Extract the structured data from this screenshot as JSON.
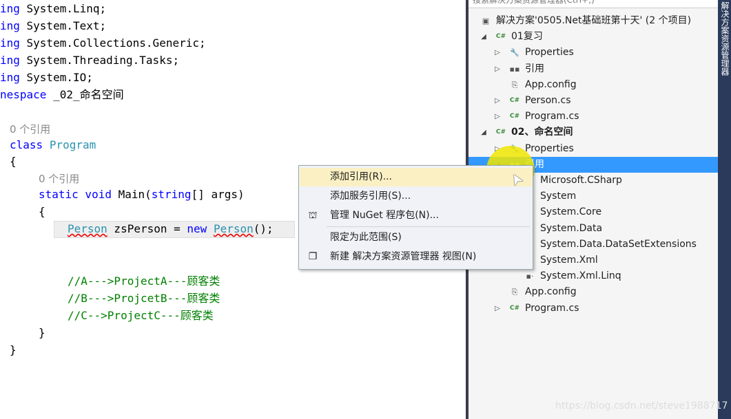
{
  "editor": {
    "usings": [
      "ing System.Linq;",
      "ing System.Text;",
      "ing System.Collections.Generic;",
      "ing System.Threading.Tasks;",
      "ing System.IO;"
    ],
    "namespace_kw": "nespace",
    "namespace_name": " _02_命名空间",
    "ref_class": "0 个引用",
    "class_kw": "class",
    "class_name": "Program",
    "brace_open": "{",
    "ref_main": "0 个引用",
    "main_sig_kw": "static void",
    "main_name": " Main(",
    "string_kw": "string",
    "main_args": "[] args)",
    "brace2": "{",
    "stmt_type": "Person",
    "stmt_var": " zsPerson = ",
    "stmt_new": "new",
    "stmt_ctor": "Person",
    "stmt_end": "();",
    "comments": [
      "//A--->ProjectA---顾客类",
      "//B--->ProjcetB---顾客类",
      "//C-->ProjectC---顾客类"
    ],
    "brace3": "}",
    "brace4": "}"
  },
  "solution_explorer": {
    "search_placeholder": "搜索解决方案资源管理器(Ctrl+;)",
    "side_tab": "解决方案资源管理器",
    "items": [
      {
        "label": "解决方案'0505.Net基础班第十天' (2 个项目)",
        "icon": "solution-icon",
        "level": 0,
        "expander": ""
      },
      {
        "label": "01复习",
        "icon": "csharp-project-icon",
        "level": 1,
        "expander": "◢"
      },
      {
        "label": "Properties",
        "icon": "wrench-icon",
        "level": 2,
        "expander": "▷"
      },
      {
        "label": "引用",
        "icon": "references-icon",
        "level": 2,
        "expander": "▷"
      },
      {
        "label": "App.config",
        "icon": "config-file-icon",
        "level": 2,
        "expander": ""
      },
      {
        "label": "Person.cs",
        "icon": "csharp-file-icon",
        "level": 2,
        "expander": "▷"
      },
      {
        "label": "Program.cs",
        "icon": "csharp-file-icon",
        "level": 2,
        "expander": "▷"
      },
      {
        "label": "02、命名空间",
        "icon": "csharp-project-icon",
        "level": 1,
        "expander": "◢",
        "bold": true
      },
      {
        "label": "Properties",
        "icon": "wrench-icon",
        "level": 2,
        "expander": "▷"
      },
      {
        "label": "引用",
        "icon": "references-icon",
        "level": 2,
        "expander": "◢",
        "selected": true
      },
      {
        "label": "Microsoft.CSharp",
        "icon": "reference-icon",
        "level": 3,
        "expander": ""
      },
      {
        "label": "System",
        "icon": "reference-icon",
        "level": 3,
        "expander": ""
      },
      {
        "label": "System.Core",
        "icon": "reference-icon",
        "level": 3,
        "expander": ""
      },
      {
        "label": "System.Data",
        "icon": "reference-icon",
        "level": 3,
        "expander": ""
      },
      {
        "label": "System.Data.DataSetExtensions",
        "icon": "reference-icon",
        "level": 3,
        "expander": ""
      },
      {
        "label": "System.Xml",
        "icon": "reference-icon",
        "level": 3,
        "expander": ""
      },
      {
        "label": "System.Xml.Linq",
        "icon": "reference-icon",
        "level": 3,
        "expander": ""
      },
      {
        "label": "App.config",
        "icon": "config-file-icon",
        "level": 2,
        "expander": ""
      },
      {
        "label": "Program.cs",
        "icon": "csharp-file-icon",
        "level": 2,
        "expander": "▷"
      }
    ]
  },
  "context_menu": {
    "items": [
      {
        "label": "添加引用(R)...",
        "icon": "",
        "highlighted": true
      },
      {
        "label": "添加服务引用(S)...",
        "icon": ""
      },
      {
        "label": "管理 NuGet 程序包(N)...",
        "icon": "nuget-icon"
      },
      {
        "label": "限定为此范围(S)",
        "icon": ""
      },
      {
        "label": "新建 解决方案资源管理器 视图(N)",
        "icon": "new-view-icon"
      }
    ]
  },
  "watermark": "https://blog.csdn.net/steve1988717"
}
